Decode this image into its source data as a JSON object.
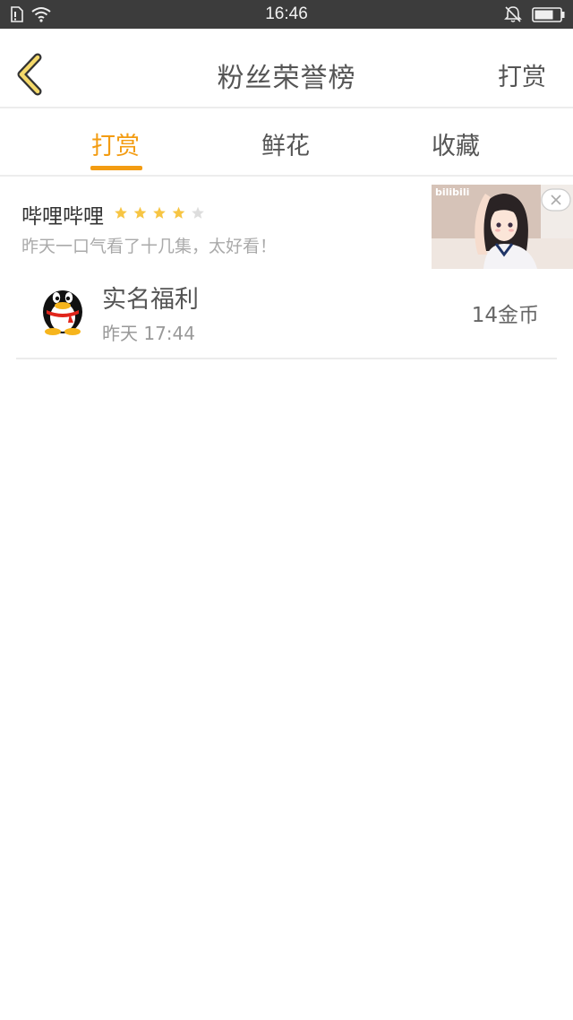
{
  "status_bar": {
    "time": "16:46"
  },
  "header": {
    "title": "粉丝荣誉榜",
    "action_label": "打赏"
  },
  "tabs": [
    {
      "label": "打赏",
      "active": true
    },
    {
      "label": "鲜花",
      "active": false
    },
    {
      "label": "收藏",
      "active": false
    }
  ],
  "ad": {
    "title": "哔哩哔哩",
    "rating": 4,
    "rating_max": 5,
    "description": "昨天一口气看了十几集，太好看！",
    "image_logo_text": "bilibili"
  },
  "list": [
    {
      "name": "实名福利",
      "time": "昨天 17:44",
      "amount": "14金币"
    }
  ],
  "colors": {
    "accent": "#f39c12",
    "star": "#f7c543",
    "star_empty": "#dddddd"
  }
}
